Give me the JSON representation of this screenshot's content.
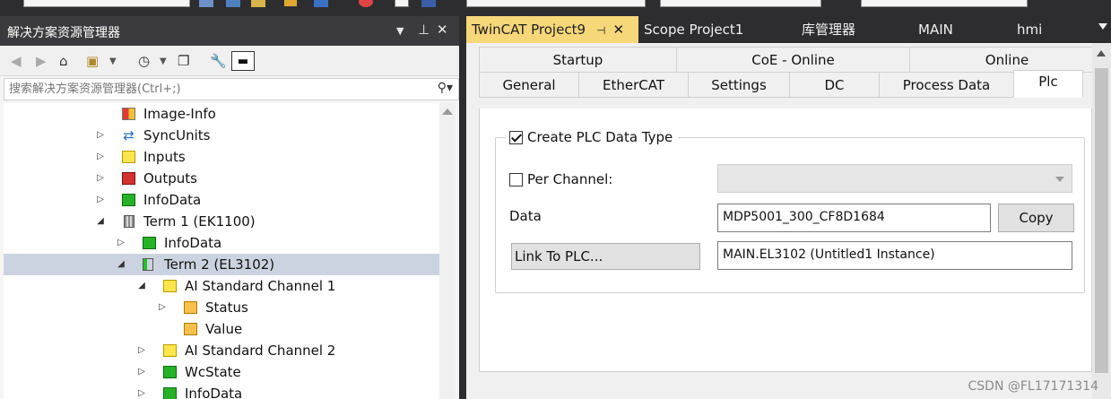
{
  "solution_explorer": {
    "title": "解决方案资源管理器",
    "pin_icon": "pin-icon",
    "search_placeholder": "搜索解决方案资源管理器(Ctrl+;)",
    "tree": [
      {
        "label": "Image-Info",
        "icon": "image-info-icon"
      },
      {
        "label": "SyncUnits",
        "icon": "sync-icon"
      },
      {
        "label": "Inputs",
        "icon": "inputs-icon"
      },
      {
        "label": "Outputs",
        "icon": "outputs-icon"
      },
      {
        "label": "InfoData",
        "icon": "infodata-icon"
      },
      {
        "label": "Term 1 (EK1100)",
        "icon": "terminal-icon"
      },
      {
        "label": "InfoData",
        "icon": "infodata-icon"
      },
      {
        "label": "Term 2 (EL3102)",
        "icon": "terminal-icon",
        "selected": true
      },
      {
        "label": "AI Standard Channel 1",
        "icon": "channel-icon"
      },
      {
        "label": "Status",
        "icon": "variable-icon"
      },
      {
        "label": "Value",
        "icon": "variable-icon"
      },
      {
        "label": "AI Standard Channel 2",
        "icon": "channel-icon"
      },
      {
        "label": "WcState",
        "icon": "wcstate-icon"
      },
      {
        "label": "InfoData",
        "icon": "infodata-icon"
      }
    ]
  },
  "document_tabs": [
    {
      "label": "TwinCAT Project9",
      "active": true
    },
    {
      "label": "Scope Project1"
    },
    {
      "label": "库管理器"
    },
    {
      "label": "MAIN"
    },
    {
      "label": "hmi"
    }
  ],
  "property_tabs_row1": [
    "Startup",
    "CoE - Online",
    "Online"
  ],
  "property_tabs_row2": [
    "General",
    "EtherCAT",
    "Settings",
    "DC",
    "Process Data",
    "Plc"
  ],
  "active_property_tab": "Plc",
  "plc": {
    "create_plc_data_type": {
      "label": "Create PLC Data Type",
      "checked": true
    },
    "per_channel": {
      "label": "Per Channel:",
      "checked": false,
      "value": ""
    },
    "data_label": "Data",
    "data_value": "MDP5001_300_CF8D1684",
    "copy_button": "Copy",
    "link_button": "Link To PLC...",
    "link_value": "MAIN.EL3102 (Untitled1 Instance)"
  },
  "watermark": "CSDN @FL17171314",
  "colors": {
    "active_doc_tab": "#f6d779",
    "dark_chrome": "#2d2d30",
    "tree_selection": "#ccd3e0"
  }
}
